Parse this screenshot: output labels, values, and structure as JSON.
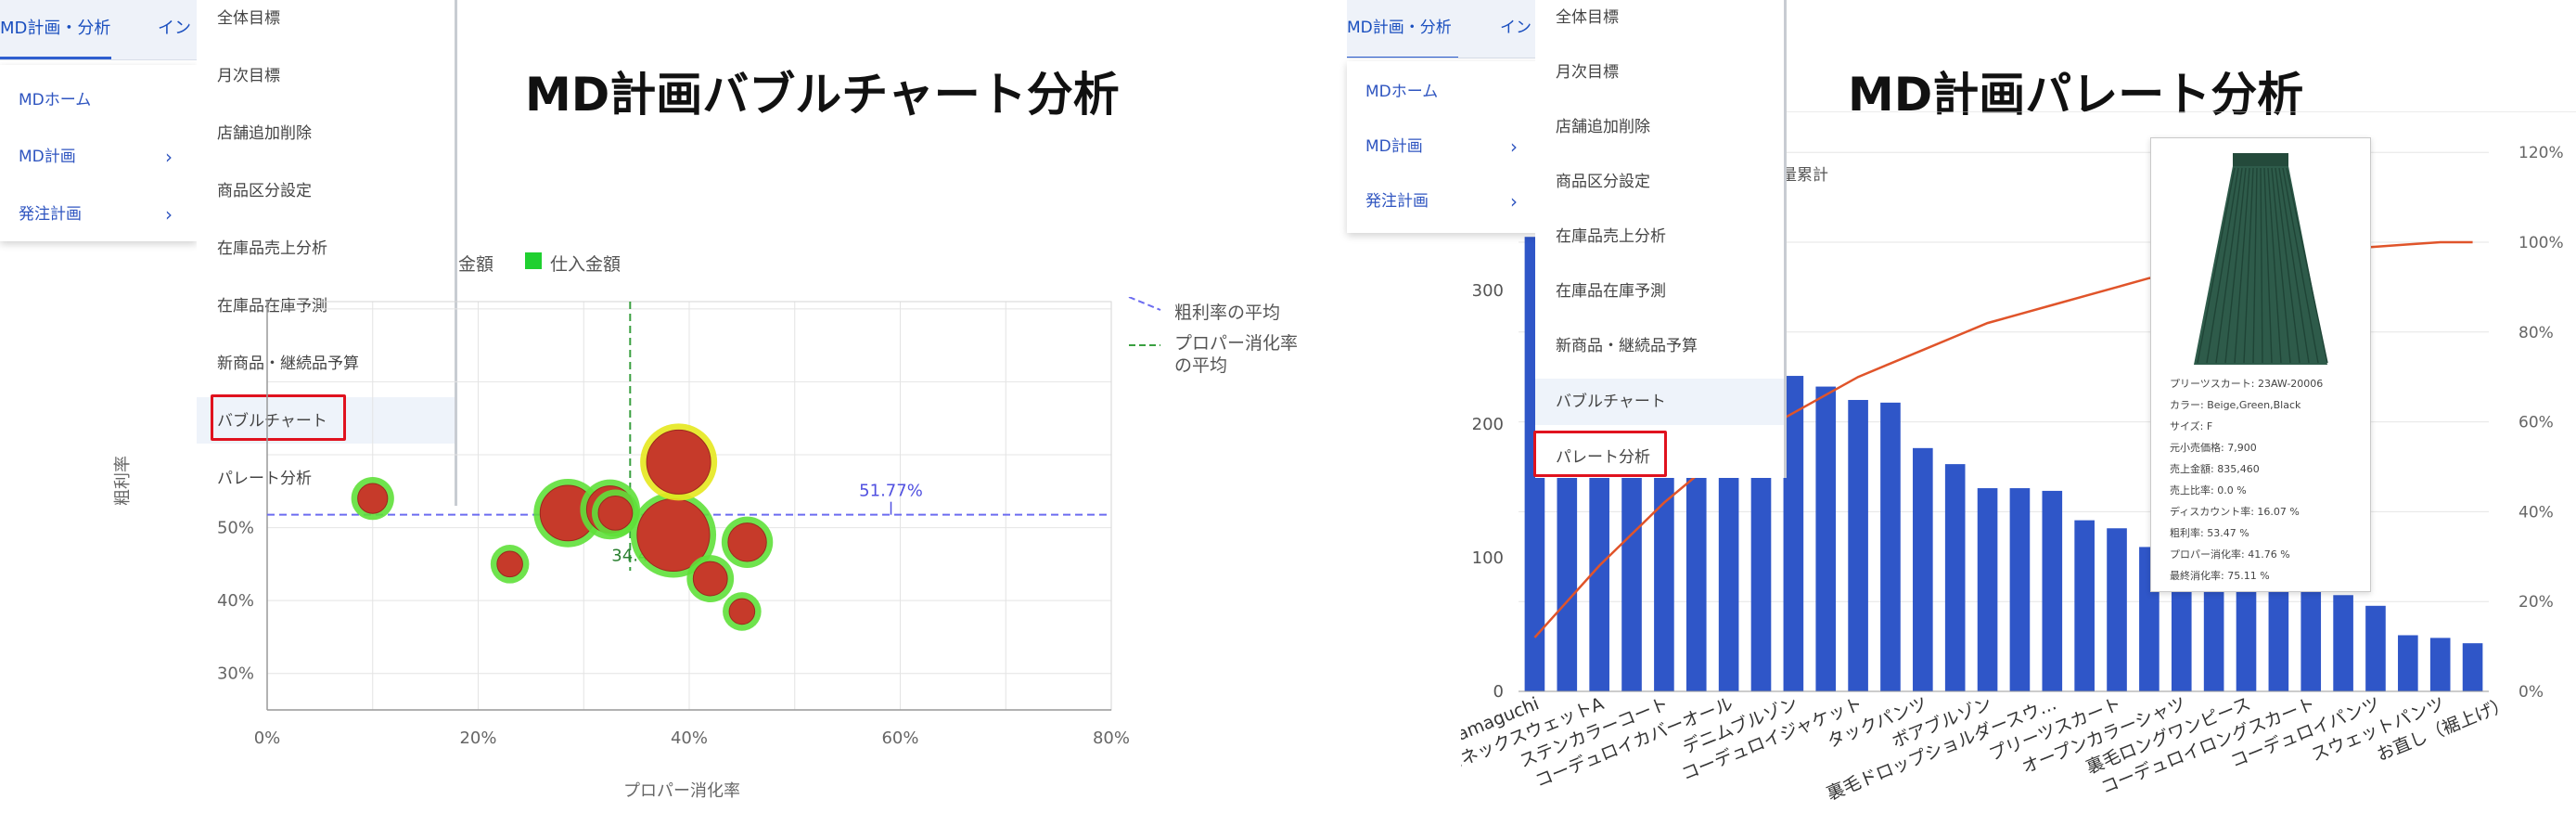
{
  "left_panel": {
    "title": "MD計画バブルチャート分析",
    "tabs": [
      "MD計画・分析",
      "イン"
    ],
    "submenu": [
      {
        "label": "MDホーム",
        "chevron": false
      },
      {
        "label": "MD計画",
        "chevron": true
      },
      {
        "label": "発注計画",
        "chevron": true
      }
    ],
    "menu_items": [
      "全体目標",
      "月次目標",
      "店舗追加削除",
      "商品区分設定",
      "在庫品売上分析",
      "在庫品在庫予測",
      "新商品・継続品予算",
      "バブルチャート",
      "パレート分析"
    ],
    "highlighted_item": "バブルチャート",
    "legend_top": [
      {
        "label": "金額",
        "color": "#1a8cd8"
      },
      {
        "label": "仕入金額",
        "color": "#20d030"
      }
    ],
    "legend_right": [
      {
        "label": "粗利率の平均",
        "color": "#6c6cf0"
      },
      {
        "label": "プロパー消化率の平均",
        "color": "#3aa040"
      }
    ],
    "chart_data": {
      "type": "scatter",
      "title": "",
      "xlabel": "プロパー消化率",
      "ylabel": "粗利率",
      "x_ticks": [
        "0%",
        "20%",
        "40%",
        "60%",
        "80%"
      ],
      "y_ticks": [
        "30%",
        "40%",
        "50%"
      ],
      "xlim": [
        0,
        80
      ],
      "ylim": [
        25,
        81
      ],
      "avg_y_label": "51.77%",
      "avg_y_value": 51.77,
      "avg_x_label": "34.4",
      "avg_x_value": 34.4,
      "points": [
        {
          "x": 10,
          "y": 54,
          "size": 7
        },
        {
          "x": 23,
          "y": 45,
          "size": 6
        },
        {
          "x": 28.5,
          "y": 52,
          "size": 13
        },
        {
          "x": 32.5,
          "y": 52.5,
          "size": 11
        },
        {
          "x": 33,
          "y": 52,
          "size": 8
        },
        {
          "x": 38.5,
          "y": 49,
          "size": 17
        },
        {
          "x": 39,
          "y": 59,
          "size": 15
        },
        {
          "x": 42,
          "y": 43,
          "size": 8
        },
        {
          "x": 45.5,
          "y": 48,
          "size": 9
        },
        {
          "x": 45,
          "y": 38.5,
          "size": 6
        }
      ]
    }
  },
  "right_panel": {
    "title": "MD計画パレート分析",
    "tabs": [
      "MD計画・分析",
      "イン"
    ],
    "submenu": [
      {
        "label": "MDホーム",
        "chevron": false
      },
      {
        "label": "MD計画",
        "chevron": true
      },
      {
        "label": "発注計画",
        "chevron": true
      }
    ],
    "menu_items": [
      "全体目標",
      "月次目標",
      "店舗追加削除",
      "商品区分設定",
      "在庫品売上分析",
      "在庫品在庫予測",
      "新商品・継続品予算",
      "バブルチャート",
      "パレート分析"
    ],
    "highlighted_item": "バブルチャート",
    "legend_partial": "量累計",
    "chart_data": {
      "type": "bar",
      "series": [
        {
          "name": "",
          "type": "bar",
          "color": "#2f56c8",
          "values": [
            340,
            340,
            340,
            340,
            322,
            306,
            262,
            244,
            236,
            228,
            218,
            216,
            182,
            170,
            152,
            152,
            150,
            128,
            122,
            108,
            90,
            88,
            86,
            84,
            76,
            72,
            64,
            42,
            40,
            36
          ]
        },
        {
          "name": "",
          "type": "line",
          "color": "#e0542a",
          "values": [
            12,
            20,
            28,
            35,
            42,
            48,
            53,
            58,
            62,
            66,
            70,
            73,
            76,
            79,
            82,
            84,
            86,
            88,
            90,
            92,
            93,
            94.5,
            95.5,
            96.5,
            97.5,
            98.5,
            99,
            99.5,
            100,
            100
          ]
        }
      ],
      "y_ticks": [
        "0",
        "100",
        "200",
        "300"
      ],
      "y2_ticks": [
        "0%",
        "20%",
        "40%",
        "60%",
        "80%",
        "100%",
        "120%"
      ],
      "ylim": [
        0,
        420
      ],
      "y2lim": [
        0,
        125
      ],
      "x_labels": [
        "...ko-yamaguchi",
        "...ネックスウェットA",
        "ステンカラーコート",
        "コーデュロイカバーオール",
        "デニムブルゾン",
        "コーデュロイジャケット",
        "タックパンツ",
        "ボアブルゾン",
        "裏毛ドロップショルダースウ…",
        "プリーツスカート",
        "オープンカラーシャツ",
        "裏毛ロングワンピース",
        "コーデュロイロングスカート",
        "コーデュロイパンツ",
        "スウェットパンツ",
        "お直し（裾上げ）"
      ]
    },
    "tooltip": {
      "lines": [
        "プリーツスカート: 23AW-20006",
        "カラー: Beige,Green,Black",
        "サイズ: F",
        "元小売価格: 7,900",
        "売上金額: 835,460",
        "売上比率: 0.0 %",
        "ディスカウント率: 16.07 %",
        "粗利率: 53.47 %",
        "プロパー消化率: 41.76 %",
        "最終消化率: 75.11 %"
      ],
      "image_color": "#2e5b4a"
    }
  }
}
